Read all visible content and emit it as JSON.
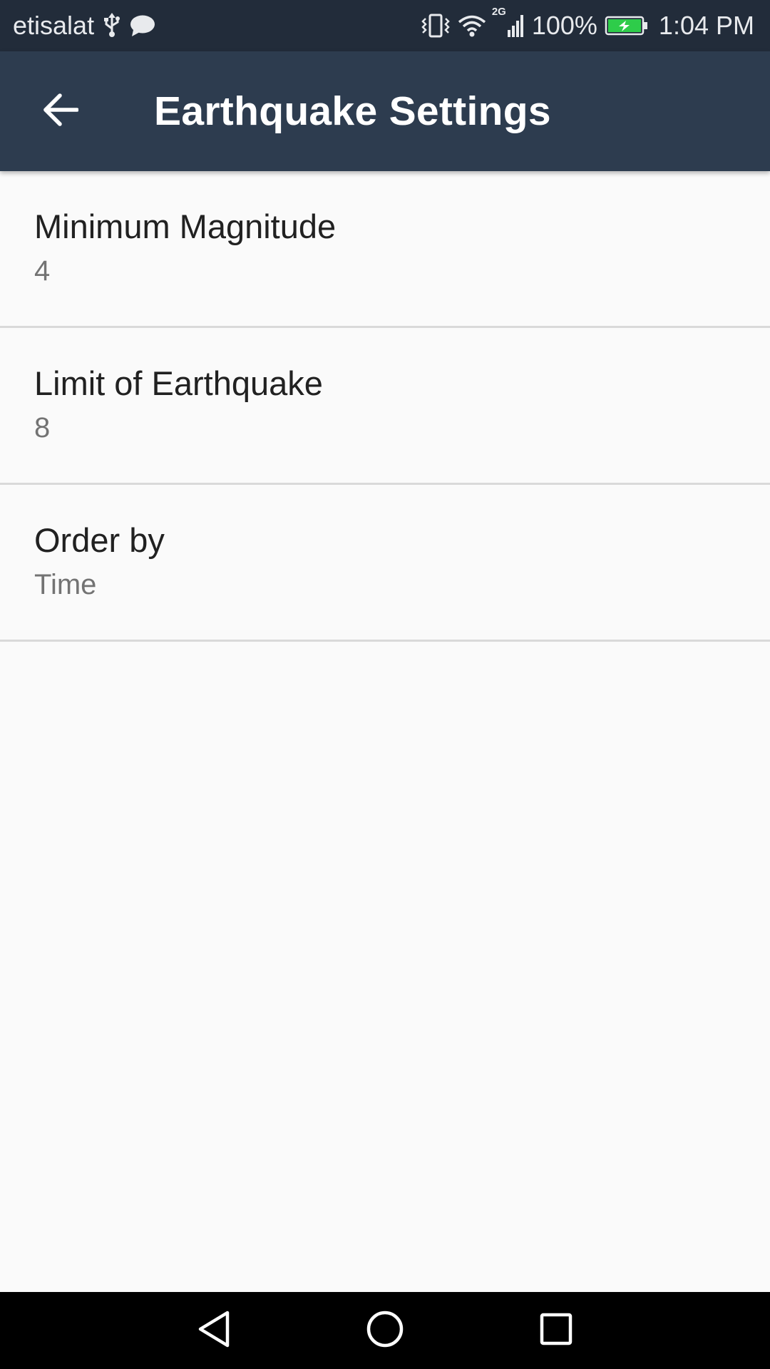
{
  "status_bar": {
    "carrier": "etisalat",
    "network_type": "2G",
    "battery_percent": "100%",
    "time": "1:04 PM",
    "icons": [
      "usb-icon",
      "message-icon",
      "vibrate-icon",
      "wifi-icon",
      "signal-icon",
      "battery-charging-icon"
    ]
  },
  "app_bar": {
    "title": "Earthquake Settings",
    "back_icon": "arrow-back-icon"
  },
  "preferences": [
    {
      "title": "Minimum Magnitude",
      "summary": "4"
    },
    {
      "title": "Limit of Earthquake",
      "summary": "8"
    },
    {
      "title": "Order by",
      "summary": "Time"
    }
  ],
  "nav_bar": {
    "icons": [
      "back-triangle-icon",
      "home-circle-icon",
      "recents-square-icon"
    ]
  },
  "colors": {
    "status_bar": "#222c3a",
    "app_bar": "#2d3c4f",
    "background": "#fafafa",
    "battery": "#2ecc4a"
  }
}
